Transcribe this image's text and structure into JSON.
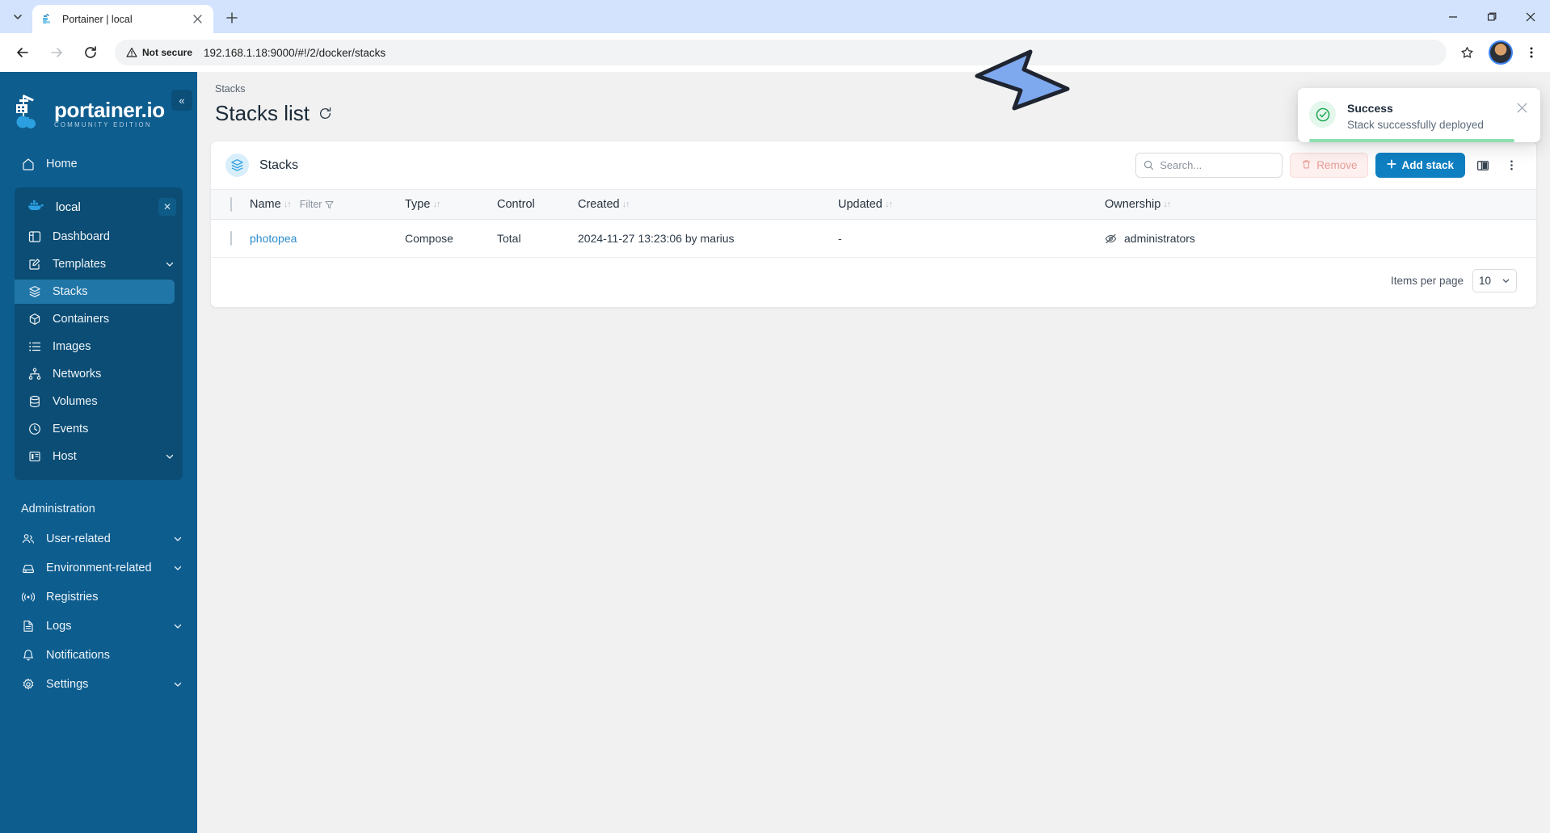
{
  "browser": {
    "tab": {
      "title": "Portainer | local",
      "favicon_icon": "portainer-favicon"
    },
    "new_tab_label": "+",
    "tab_list_icon": "chevron-down-icon",
    "back_icon": "arrow-left-icon",
    "forward_icon": "arrow-right-icon",
    "reload_icon": "reload-icon",
    "security_label": "Not secure",
    "security_icon": "warning-triangle-icon",
    "url": "192.168.1.18:9000/#!/2/docker/stacks",
    "bookmark_icon": "star-icon",
    "profile_icon": "avatar",
    "menu_icon": "kebab-menu-icon",
    "window_minimize": "—",
    "window_maximize": "❐",
    "window_close": "✕"
  },
  "sidebar": {
    "logo_main": "portainer.io",
    "logo_sub": "COMMUNITY EDITION",
    "collapse_icon": "«",
    "home": {
      "label": "Home",
      "icon": "home-icon"
    },
    "environment": {
      "name": "local",
      "icon": "docker-whale-icon",
      "close_icon": "✕",
      "items": [
        {
          "label": "Dashboard",
          "icon": "dashboard-icon",
          "chevron": false,
          "active": false
        },
        {
          "label": "Templates",
          "icon": "templates-icon",
          "chevron": true,
          "active": false
        },
        {
          "label": "Stacks",
          "icon": "stacks-icon",
          "chevron": false,
          "active": true
        },
        {
          "label": "Containers",
          "icon": "containers-icon",
          "chevron": false,
          "active": false
        },
        {
          "label": "Images",
          "icon": "images-icon",
          "chevron": false,
          "active": false
        },
        {
          "label": "Networks",
          "icon": "networks-icon",
          "chevron": false,
          "active": false
        },
        {
          "label": "Volumes",
          "icon": "volumes-icon",
          "chevron": false,
          "active": false
        },
        {
          "label": "Events",
          "icon": "events-icon",
          "chevron": false,
          "active": false
        },
        {
          "label": "Host",
          "icon": "host-icon",
          "chevron": true,
          "active": false
        }
      ]
    },
    "admin_label": "Administration",
    "admin_items": [
      {
        "label": "User-related",
        "icon": "users-icon",
        "chevron": true
      },
      {
        "label": "Environment-related",
        "icon": "environment-icon",
        "chevron": true
      },
      {
        "label": "Registries",
        "icon": "registries-icon",
        "chevron": false
      },
      {
        "label": "Logs",
        "icon": "logs-icon",
        "chevron": true
      },
      {
        "label": "Notifications",
        "icon": "bell-icon",
        "chevron": false
      },
      {
        "label": "Settings",
        "icon": "gear-icon",
        "chevron": true
      }
    ]
  },
  "main": {
    "breadcrumb": "Stacks",
    "page_title": "Stacks list",
    "refresh_icon": "refresh-icon",
    "card": {
      "icon": "stacks-icon",
      "title": "Stacks",
      "search_placeholder": "Search...",
      "search_value": "",
      "search_icon": "search-icon",
      "search_clear_icon": "✕",
      "remove_label": "Remove",
      "remove_icon": "trash-icon",
      "add_label": "Add stack",
      "add_icon": "+",
      "columns_icon": "columns-layout-icon",
      "more_icon": "kebab-menu-icon"
    },
    "table": {
      "select_all_checkbox": false,
      "columns": [
        {
          "label": "Name",
          "sort": "↓↑",
          "filter_label": "Filter",
          "filter_icon": "funnel-icon"
        },
        {
          "label": "Type",
          "sort": "↓↑"
        },
        {
          "label": "Control",
          "sort": ""
        },
        {
          "label": "Created",
          "sort": "↓↑"
        },
        {
          "label": "Updated",
          "sort": "↓↑"
        },
        {
          "label": "Ownership",
          "sort": "↓↑"
        }
      ],
      "rows": [
        {
          "selected": false,
          "name": "photopea",
          "type": "Compose",
          "control": "Total",
          "created": "2024-11-27 13:23:06 by marius",
          "updated": "-",
          "ownership": "administrators",
          "ownership_icon": "eye-off-icon"
        }
      ],
      "items_per_page_label": "Items per page",
      "items_per_page_value": "10",
      "items_per_page_chevron": "chevron-down-icon"
    }
  },
  "toast": {
    "title": "Success",
    "message": "Stack successfully deployed",
    "icon": "check-circle-icon",
    "close_icon": "✕",
    "accent_color": "#17a44c",
    "progress_color": "#8ddfaf"
  },
  "annotation": {
    "arrow_icon": "arrow-pointing-right-down",
    "arrow_fill": "#7fa9ef",
    "arrow_stroke": "#1e2430"
  }
}
